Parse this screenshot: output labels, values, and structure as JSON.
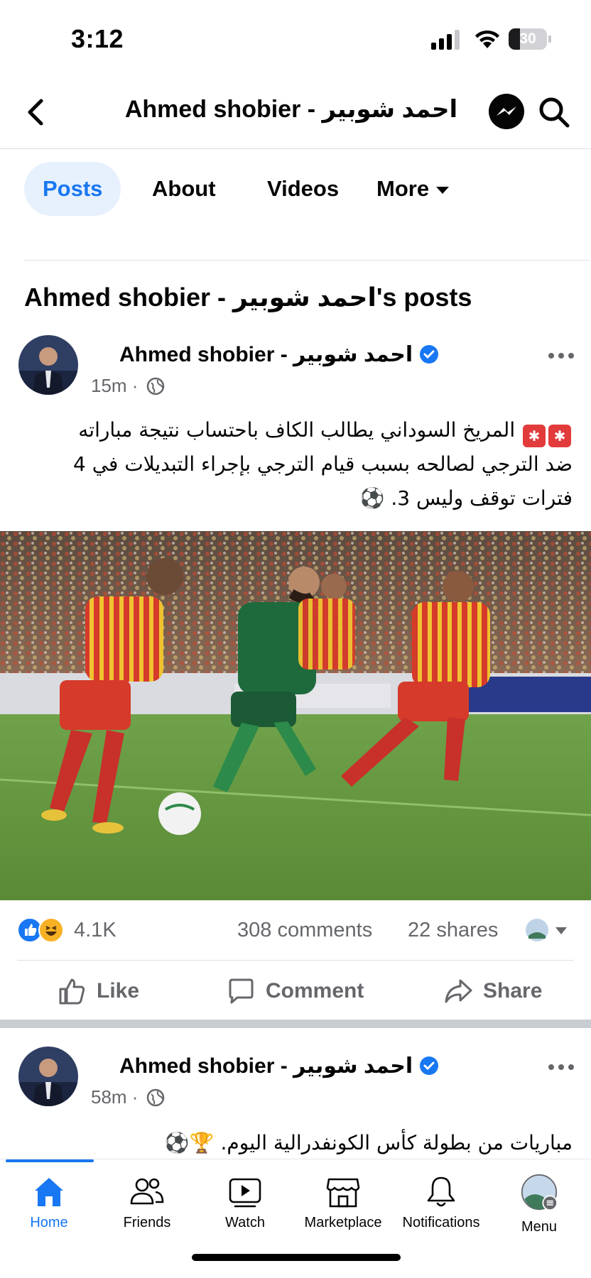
{
  "status_bar": {
    "time": "3:12",
    "battery": "30",
    "battery_level": 0.3
  },
  "header": {
    "title": "Ahmed shobier - احمد شوبير"
  },
  "tabs": [
    {
      "label": "Posts",
      "active": true
    },
    {
      "label": "About",
      "active": false
    },
    {
      "label": "Videos",
      "active": false
    },
    {
      "label": "More",
      "active": false
    }
  ],
  "section": {
    "heading": "Ahmed shobier - احمد شوبير's posts"
  },
  "posts": [
    {
      "author": "Ahmed shobier - احمد شوبير",
      "time": "15m",
      "text_line1": "المريخ السوداني يطالب الكاف باحتساب نتيجة مباراته",
      "text_line2": "ضد الترجي لصالحه بسبب قيام الترجي بإجراء التبديلات في 4",
      "text_line3": "فترات توقف وليس 3.",
      "reactions_count": "4.1K",
      "comments": "308 comments",
      "shares": "22 shares",
      "actions": {
        "like": "Like",
        "comment": "Comment",
        "share": "Share"
      }
    },
    {
      "author": "Ahmed shobier - احمد شوبير",
      "time": "58m",
      "text_line1": "مباريات من بطولة كأس الكونفدرالية اليوم."
    }
  ],
  "bottom_nav": [
    {
      "label": "Home",
      "icon": "home-icon",
      "active": true
    },
    {
      "label": "Friends",
      "icon": "friends-icon",
      "active": false
    },
    {
      "label": "Watch",
      "icon": "watch-icon",
      "active": false
    },
    {
      "label": "Marketplace",
      "icon": "marketplace-icon",
      "active": false
    },
    {
      "label": "Notifications",
      "icon": "bell-icon",
      "active": false
    },
    {
      "label": "Menu",
      "icon": "menu-avatar",
      "active": false
    }
  ],
  "colors": {
    "accent": "#1877f2",
    "secondary_text": "#65676b",
    "active_tab_bg": "#e7f0fd"
  }
}
